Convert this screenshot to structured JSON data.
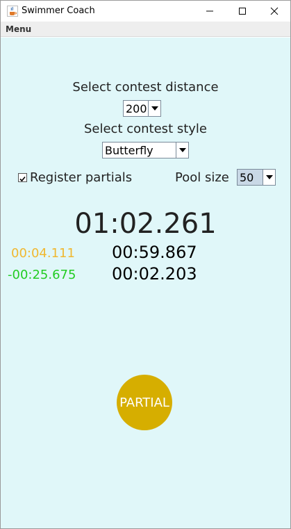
{
  "window": {
    "title": "Swimmer Coach"
  },
  "menubar": {
    "menu_label": "Menu"
  },
  "form": {
    "distance_label": "Select contest distance",
    "distance_value": "200",
    "style_label": "Select contest style",
    "style_value": "Butterfly",
    "register_partials_label": "Register partials",
    "register_partials_checked": true,
    "pool_size_label": "Pool size",
    "pool_size_value": "50"
  },
  "timer": {
    "main_time": "01:02.261",
    "split_1": "00:59.867",
    "split_2": "00:02.203",
    "diff_1": "00:04.111",
    "diff_2": "-00:25.675"
  },
  "actions": {
    "partial_label": "PARTIAL"
  },
  "colors": {
    "background": "#e0f7f9",
    "diff_positive": "#f0b830",
    "diff_negative": "#22cc22",
    "partial_button": "#d6ae00"
  }
}
